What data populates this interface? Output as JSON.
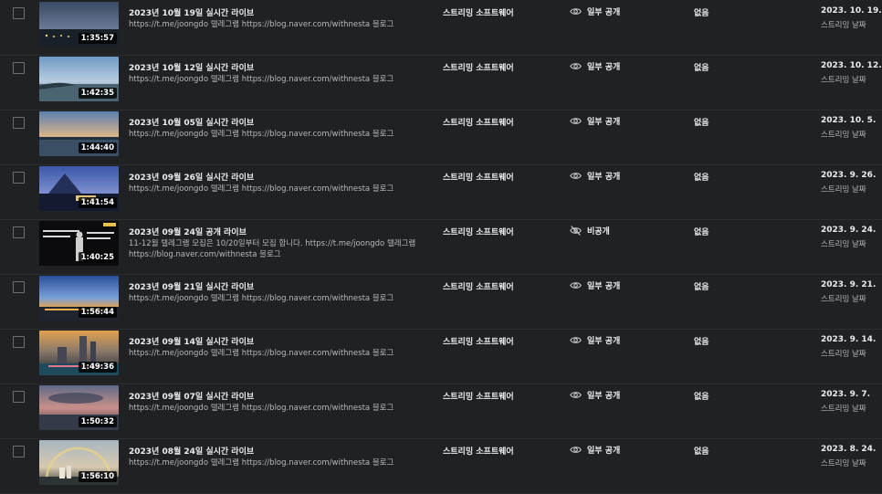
{
  "rows": [
    {
      "title": "2023년 10월 19일 실시간 라이브",
      "desc": "https://t.me/joongdo 텔레그램 https://blog.naver.com/withnesta 블로그",
      "duration": "1:35:57",
      "type": "스트리밍 소프트웨어",
      "visibility": "일부 공개",
      "visibility_icon": "eye-icon",
      "restrictions": "없음",
      "date": "2023. 10. 19.",
      "date_sub": "스트리밍 날짜"
    },
    {
      "title": "2023년 10월 12일 실시간 라이브",
      "desc": "https://t.me/joongdo 텔레그램 https://blog.naver.com/withnesta 블로그",
      "duration": "1:42:35",
      "type": "스트리밍 소프트웨어",
      "visibility": "일부 공개",
      "visibility_icon": "eye-icon",
      "restrictions": "없음",
      "date": "2023. 10. 12.",
      "date_sub": "스트리밍 날짜"
    },
    {
      "title": "2023년 10월 05일 실시간 라이브",
      "desc": "https://t.me/joongdo 텔레그램 https://blog.naver.com/withnesta 블로그",
      "duration": "1:44:40",
      "type": "스트리밍 소프트웨어",
      "visibility": "일부 공개",
      "visibility_icon": "eye-icon",
      "restrictions": "없음",
      "date": "2023. 10. 5.",
      "date_sub": "스트리밍 날짜"
    },
    {
      "title": "2023년 09월 26일 실시간 라이브",
      "desc": "https://t.me/joongdo 텔레그램 https://blog.naver.com/withnesta 블로그",
      "duration": "1:41:54",
      "type": "스트리밍 소프트웨어",
      "visibility": "일부 공개",
      "visibility_icon": "eye-icon",
      "restrictions": "없음",
      "date": "2023. 9. 26.",
      "date_sub": "스트리밍 날짜"
    },
    {
      "title": "2023년 09월 24일 공개 라이브",
      "desc": "11-12월 텔레그램 모집은 10/20일부터 모집 합니다. https://t.me/joongdo 텔레그램 https://blog.naver.com/withnesta 블로그",
      "duration": "1:40:25",
      "type": "스트리밍 소프트웨어",
      "visibility": "비공개",
      "visibility_icon": "eye-off-icon",
      "restrictions": "없음",
      "date": "2023. 9. 24.",
      "date_sub": "스트리밍 날짜"
    },
    {
      "title": "2023년 09월 21일 실시간 라이브",
      "desc": "https://t.me/joongdo 텔레그램 https://blog.naver.com/withnesta 블로그",
      "duration": "1:56:44",
      "type": "스트리밍 소프트웨어",
      "visibility": "일부 공개",
      "visibility_icon": "eye-icon",
      "restrictions": "없음",
      "date": "2023. 9. 21.",
      "date_sub": "스트리밍 날짜"
    },
    {
      "title": "2023년 09월 14일 실시간 라이브",
      "desc": "https://t.me/joongdo 텔레그램 https://blog.naver.com/withnesta 블로그",
      "duration": "1:49:36",
      "type": "스트리밍 소프트웨어",
      "visibility": "일부 공개",
      "visibility_icon": "eye-icon",
      "restrictions": "없음",
      "date": "2023. 9. 14.",
      "date_sub": "스트리밍 날짜"
    },
    {
      "title": "2023년 09월 07일 실시간 라이브",
      "desc": "https://t.me/joongdo 텔레그램 https://blog.naver.com/withnesta 블로그",
      "duration": "1:50:32",
      "type": "스트리밍 소프트웨어",
      "visibility": "일부 공개",
      "visibility_icon": "eye-icon",
      "restrictions": "없음",
      "date": "2023. 9. 7.",
      "date_sub": "스트리밍 날짜"
    },
    {
      "title": "2023년 08월 24일 실시간 라이브",
      "desc": "https://t.me/joongdo 텔레그램 https://blog.naver.com/withnesta 블로그",
      "duration": "1:56:10",
      "type": "스트리밍 소프트웨어",
      "visibility": "일부 공개",
      "visibility_icon": "eye-icon",
      "restrictions": "없음",
      "date": "2023. 8. 24.",
      "date_sub": "스트리밍 날짜"
    }
  ],
  "colors": {
    "background": "#1f2124",
    "text_primary": "#ededed",
    "text_secondary": "#b9b9b9"
  }
}
